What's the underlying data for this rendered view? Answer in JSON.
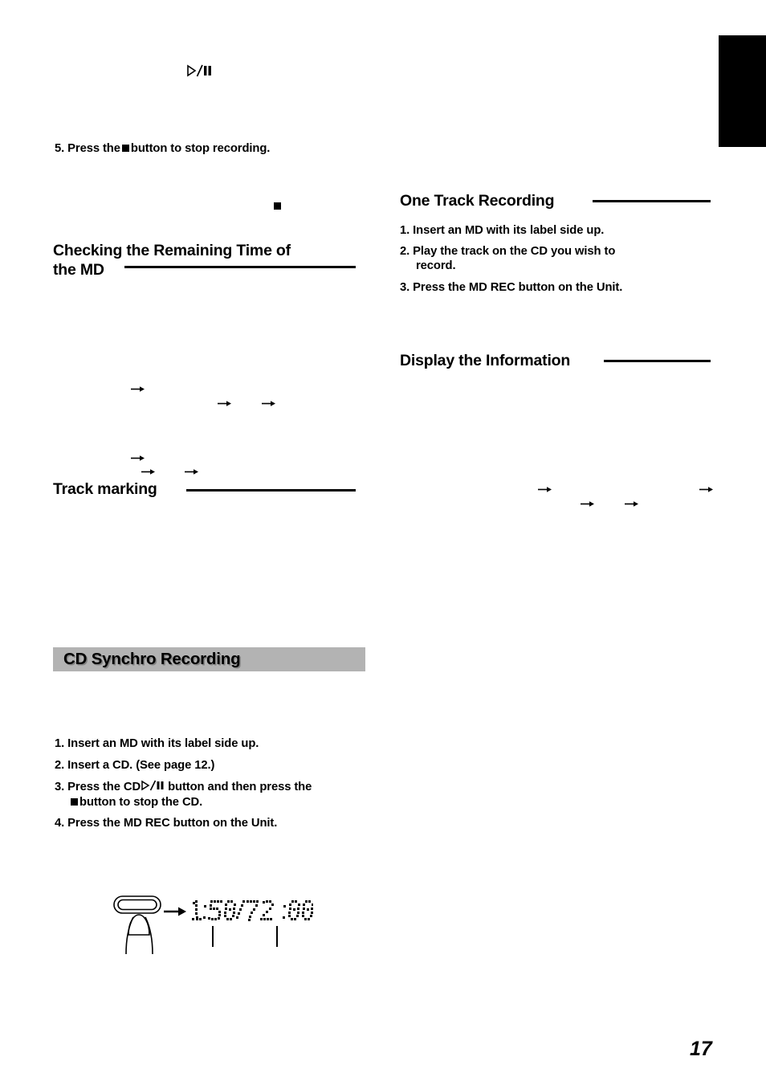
{
  "page": {
    "number": "17",
    "thumb_tab": "black-index-tab"
  },
  "left_column": {
    "orphan_playpause_glyph": "play-pause-icon",
    "step5": {
      "number": "5.",
      "text_before": "Press the",
      "glyph": "stop-icon",
      "text_after": "button to stop recording."
    },
    "orphan_stop_glyph": "stop-icon",
    "heading_remaining_time": {
      "line1": "Checking the Remaining Time of",
      "line2": "the MD"
    },
    "heading_track_marking": "Track marking",
    "arrows": [
      "arrow-right-icon",
      "arrow-right-icon",
      "arrow-right-icon",
      "arrow-right-icon",
      "arrow-right-icon",
      "arrow-right-icon"
    ]
  },
  "right_column": {
    "heading_one_track_recording": "One Track Recording",
    "one_track_steps": [
      {
        "number": "1.",
        "text": "Insert an MD with its label side up."
      },
      {
        "number": "2.",
        "text": "Play the track on the CD you wish to",
        "cont": "record."
      },
      {
        "number": "3.",
        "text": "Press the MD REC button on the Unit."
      }
    ],
    "heading_display_information": "Display the Information",
    "arrows": [
      "arrow-right-icon",
      "arrow-right-icon",
      "arrow-right-icon",
      "arrow-right-icon"
    ]
  },
  "cd_synchro": {
    "banner_title": "CD Synchro Recording",
    "banner_color": "#b3b3b3",
    "steps": [
      {
        "number": "1.",
        "text": "Insert an MD with its label side up."
      },
      {
        "number": "2.",
        "text": "Insert a CD. (See page 12.)"
      },
      {
        "number": "3.",
        "text_before": "Press the CD",
        "glyph": "play-pause-icon",
        "text_after": "button and then press the",
        "cont_glyph": "stop-icon",
        "cont_text": "button to stop the CD."
      },
      {
        "number": "4.",
        "text": "Press the MD REC button on the Unit."
      }
    ],
    "illustration": {
      "button_icon": "md-rec-button-with-finger-icon",
      "arrow": "arrow-right-icon",
      "lcd_display": "1:50/72 :00"
    }
  }
}
